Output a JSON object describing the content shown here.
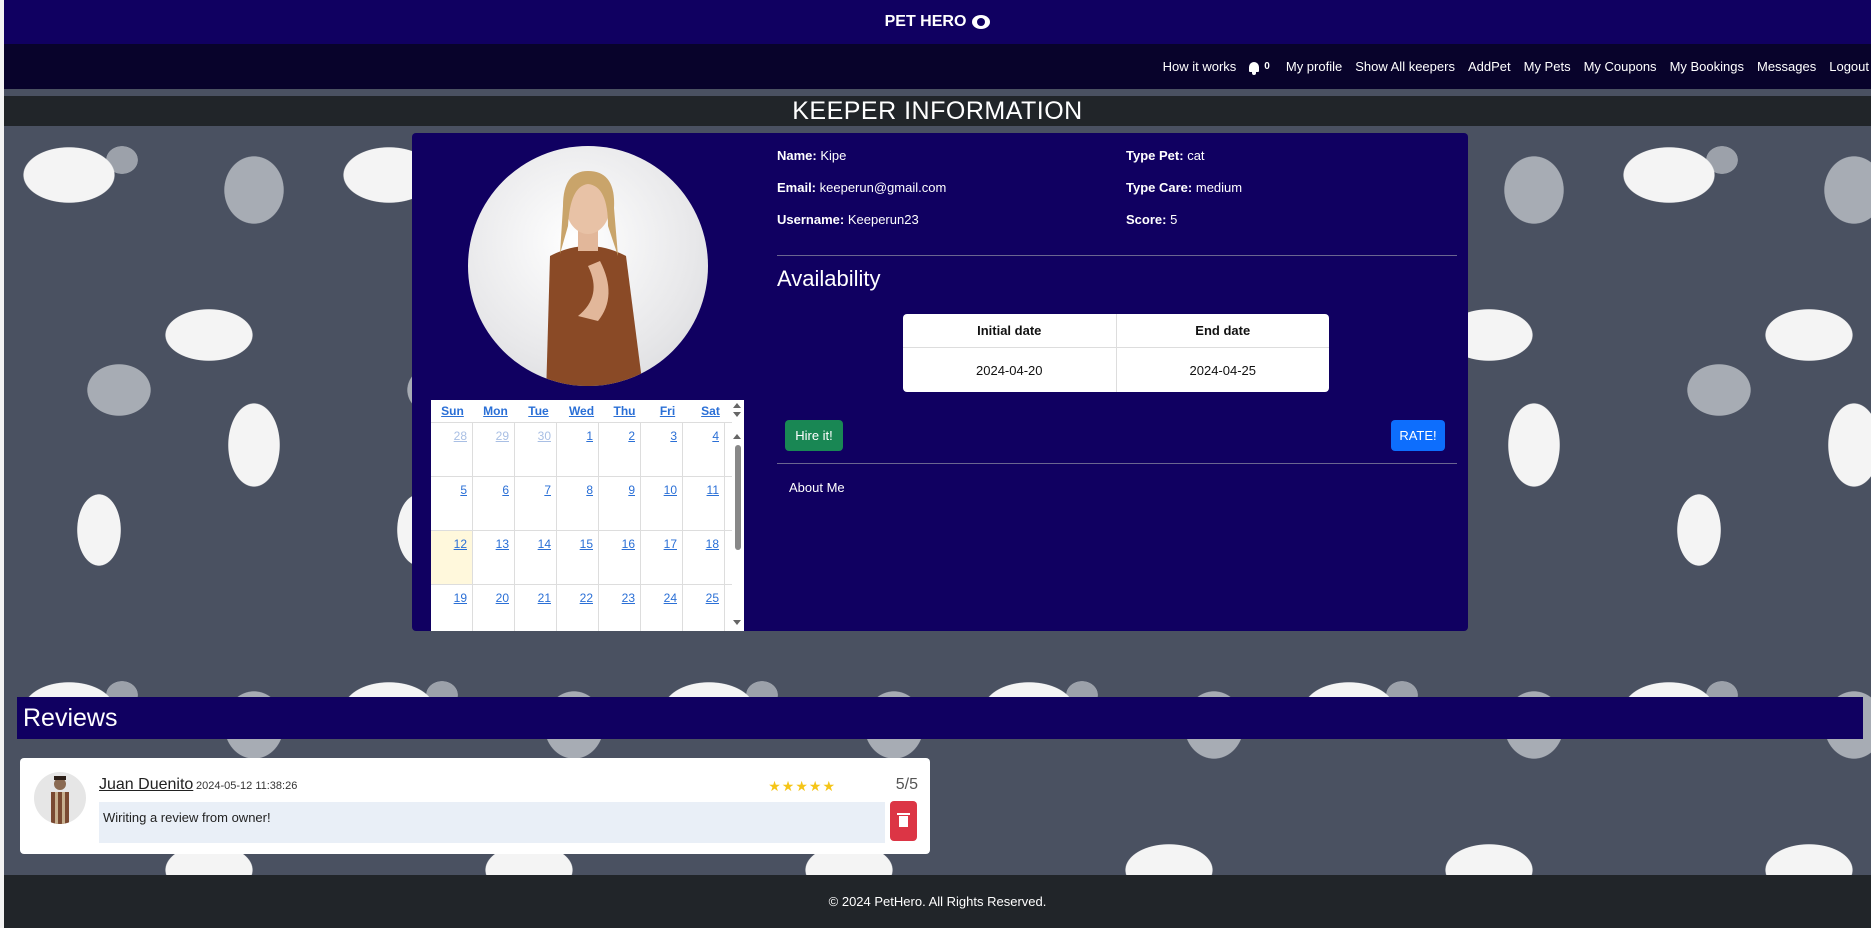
{
  "header": {
    "brand": "PET HERO"
  },
  "nav": {
    "items": [
      "How it works",
      "My profile",
      "Show All keepers",
      "AddPet",
      "My Pets",
      "My Coupons",
      "My Bookings",
      "Messages",
      "Logout"
    ],
    "notifications": "0"
  },
  "page_title": "KEEPER INFORMATION",
  "keeper": {
    "name_label": "Name:",
    "name": "Kipe",
    "email_label": "Email:",
    "email": "keeperun@gmail.com",
    "username_label": "Username:",
    "username": "Keeperun23",
    "type_pet_label": "Type Pet:",
    "type_pet": "cat",
    "type_care_label": "Type Care:",
    "type_care": "medium",
    "score_label": "Score:",
    "score": "5"
  },
  "calendar": {
    "days": [
      "Sun",
      "Mon",
      "Tue",
      "Wed",
      "Thu",
      "Fri",
      "Sat"
    ],
    "weeks": [
      [
        "28",
        "29",
        "30",
        "1",
        "2",
        "3",
        "4"
      ],
      [
        "5",
        "6",
        "7",
        "8",
        "9",
        "10",
        "11"
      ],
      [
        "12",
        "13",
        "14",
        "15",
        "16",
        "17",
        "18"
      ],
      [
        "19",
        "20",
        "21",
        "22",
        "23",
        "24",
        "25"
      ]
    ]
  },
  "availability": {
    "title": "Availability",
    "headers": [
      "Initial date",
      "End date"
    ],
    "initial_date": "2024-04-20",
    "end_date": "2024-04-25"
  },
  "buttons": {
    "hire": "Hire it!",
    "rate": "RATE!"
  },
  "about_title": "About Me",
  "reviews": {
    "title": "Reviews",
    "items": [
      {
        "author": "Juan Duenito",
        "date": "2024-05-12 11:38:26",
        "stars": "★★★★★",
        "score": "5/5",
        "text": "Wiriting a review from owner!"
      }
    ]
  },
  "footer": "© 2024 PetHero. All Rights Reserved.",
  "colors": {
    "primary_navy": "#100061",
    "hire_green": "#198754",
    "rate_blue": "#0d6efd",
    "delete_red": "#dc3545"
  }
}
